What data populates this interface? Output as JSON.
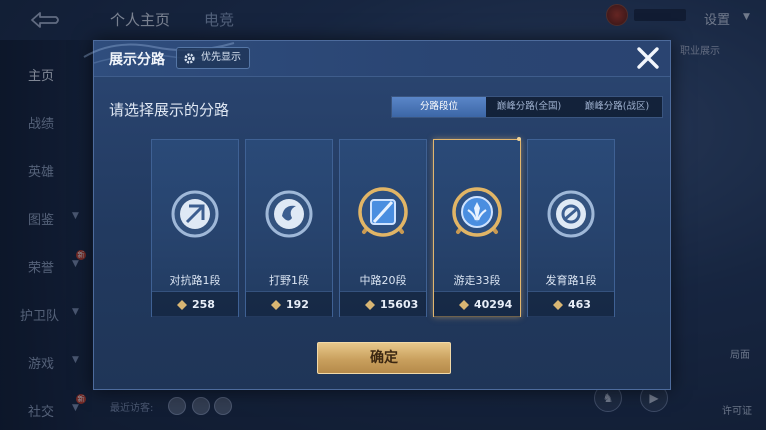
{
  "background": {
    "top_tabs": [
      "个人主页",
      "电竞"
    ],
    "settings_label": "设置",
    "sidebar_items": [
      {
        "label": "主页",
        "has_chevron": false,
        "badge": "",
        "active": true
      },
      {
        "label": "战绩",
        "has_chevron": false,
        "badge": "",
        "active": false
      },
      {
        "label": "英雄",
        "has_chevron": false,
        "badge": "",
        "active": false
      },
      {
        "label": "图鉴",
        "has_chevron": true,
        "badge": "",
        "active": false
      },
      {
        "label": "荣誉",
        "has_chevron": true,
        "badge": "新",
        "active": false
      },
      {
        "label": "护卫队",
        "has_chevron": true,
        "badge": "",
        "active": false
      },
      {
        "label": "游戏",
        "has_chevron": true,
        "badge": "",
        "active": false
      },
      {
        "label": "社交",
        "has_chevron": true,
        "badge": "新",
        "active": false
      }
    ],
    "right_text": "职业展示",
    "right_btn_1": "局面",
    "right_btn_2": "许可证",
    "recent_visitors_label": "最近访客:"
  },
  "dialog": {
    "title": "展示分路",
    "priority_label": "优先显示",
    "subtitle": "请选择展示的分路",
    "tabs": [
      "分路段位",
      "巅峰分路(全国)",
      "巅峰分路(战区)"
    ],
    "active_tab_index": 0,
    "cards": [
      {
        "label": "对抗路1段",
        "score": "258",
        "emblem": "silver",
        "selected": false
      },
      {
        "label": "打野1段",
        "score": "192",
        "emblem": "silver",
        "selected": false
      },
      {
        "label": "中路20段",
        "score": "15603",
        "emblem": "gold",
        "selected": false
      },
      {
        "label": "游走33段",
        "score": "40294",
        "emblem": "gold",
        "selected": true
      },
      {
        "label": "发育路1段",
        "score": "463",
        "emblem": "silver",
        "selected": false
      }
    ],
    "confirm_label": "确定"
  },
  "colors": {
    "accent_gold": "#e2b66e",
    "tab_active": "#4a76b8",
    "dialog_bg": "#243d63"
  }
}
